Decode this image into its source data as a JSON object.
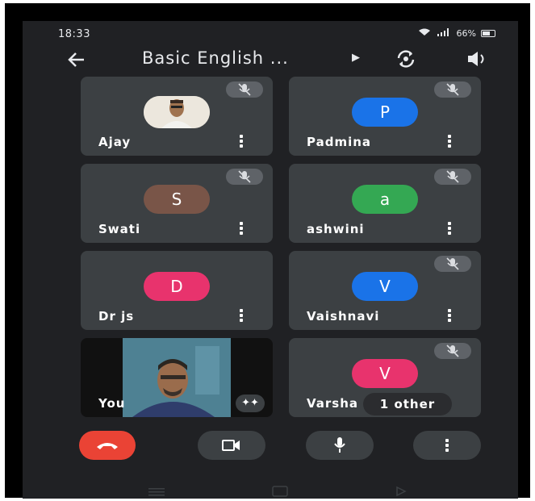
{
  "status_bar": {
    "time": "18:33",
    "battery": "66%"
  },
  "app_bar": {
    "title": "Basic English ..."
  },
  "participants": [
    {
      "name": "Ajay",
      "initial": "",
      "color": "#e9e4da"
    },
    {
      "name": "Padmina",
      "initial": "P",
      "color": "#1a73e8"
    },
    {
      "name": "Swati",
      "initial": "S",
      "color": "#795548"
    },
    {
      "name": "ashwini",
      "initial": "a",
      "color": "#34a853"
    },
    {
      "name": "Dr js",
      "initial": "D",
      "color": "#e8336d"
    },
    {
      "name": "Vaishnavi",
      "initial": "V",
      "color": "#1a73e8"
    },
    {
      "name": "You",
      "initial": "",
      "color": "#111111"
    },
    {
      "name": "Varsha",
      "initial": "V",
      "color": "#e8336d"
    }
  ],
  "others_label": "1 other",
  "colors": {
    "background": "#202124",
    "tile": "#3c4043",
    "end_call": "#ea4335"
  },
  "controls": [
    "end-call-icon",
    "camera-icon",
    "mic-icon",
    "more-options-icon"
  ]
}
